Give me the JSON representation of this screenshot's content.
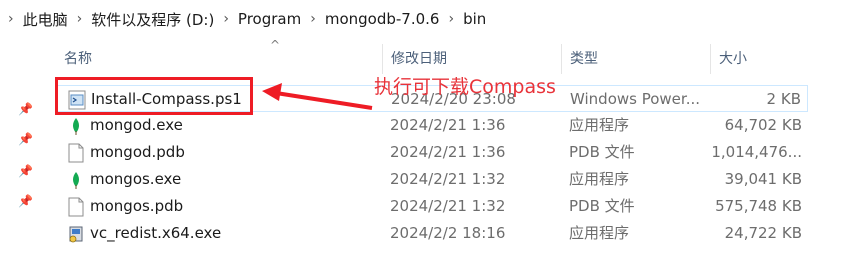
{
  "breadcrumb": {
    "items": [
      "此电脑",
      "软件以及程序 (D:)",
      "Program",
      "mongodb-7.0.6",
      "bin"
    ],
    "separator": "›"
  },
  "columns": {
    "name": "名称",
    "date": "修改日期",
    "type": "类型",
    "size": "大小"
  },
  "files": [
    {
      "name": "Install-Compass.ps1",
      "date": "2024/2/20 23:08",
      "type": "Windows Power...",
      "size": "2 KB",
      "icon": "powershell-script-icon"
    },
    {
      "name": "mongod.exe",
      "date": "2024/2/21 1:36",
      "type": "应用程序",
      "size": "64,702 KB",
      "icon": "mongodb-leaf-icon"
    },
    {
      "name": "mongod.pdb",
      "date": "2024/2/21 1:36",
      "type": "PDB 文件",
      "size": "1,014,476...",
      "icon": "document-icon"
    },
    {
      "name": "mongos.exe",
      "date": "2024/2/21 1:32",
      "type": "应用程序",
      "size": "39,041 KB",
      "icon": "mongodb-leaf-icon"
    },
    {
      "name": "mongos.pdb",
      "date": "2024/2/21 1:32",
      "type": "PDB 文件",
      "size": "575,748 KB",
      "icon": "document-icon"
    },
    {
      "name": "vc_redist.x64.exe",
      "date": "2024/2/2 18:16",
      "type": "应用程序",
      "size": "24,722 KB",
      "icon": "installer-icon"
    }
  ],
  "annotation": {
    "text": "执行可下载Compass",
    "color": "#e8333a"
  },
  "colors": {
    "highlight": "#ee1c25",
    "header_text": "#4c607a",
    "leaf_green": "#13aa52"
  }
}
